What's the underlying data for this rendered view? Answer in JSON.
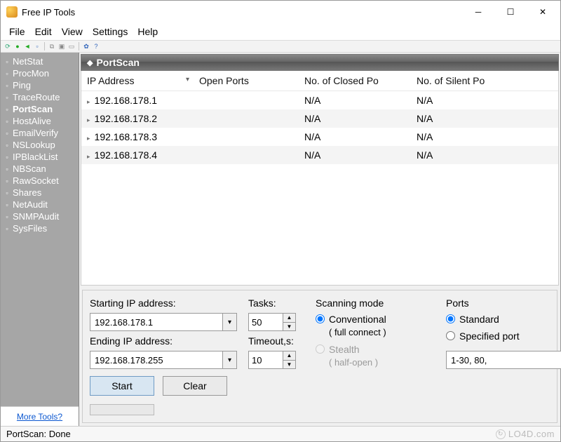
{
  "window": {
    "title": "Free IP Tools"
  },
  "menubar": [
    "File",
    "Edit",
    "View",
    "Settings",
    "Help"
  ],
  "toolbar_icons": [
    "refresh-icon",
    "play-icon",
    "back-icon",
    "save-icon",
    "sep",
    "copy-icon",
    "paste-icon",
    "clear-icon",
    "sep",
    "settings-icon",
    "help-icon"
  ],
  "sidebar": {
    "items": [
      {
        "label": "NetStat",
        "selected": false
      },
      {
        "label": "ProcMon",
        "selected": false
      },
      {
        "label": "Ping",
        "selected": false
      },
      {
        "label": "TraceRoute",
        "selected": false
      },
      {
        "label": "PortScan",
        "selected": true
      },
      {
        "label": "HostAlive",
        "selected": false
      },
      {
        "label": "EmailVerify",
        "selected": false
      },
      {
        "label": "NSLookup",
        "selected": false
      },
      {
        "label": "IPBlackList",
        "selected": false
      },
      {
        "label": "NBScan",
        "selected": false
      },
      {
        "label": "RawSocket",
        "selected": false
      },
      {
        "label": "Shares",
        "selected": false
      },
      {
        "label": "NetAudit",
        "selected": false
      },
      {
        "label": "SNMPAudit",
        "selected": false
      },
      {
        "label": "SysFiles",
        "selected": false
      }
    ],
    "footer_link": "More Tools?"
  },
  "panel": {
    "title": "PortScan"
  },
  "grid": {
    "columns": [
      "IP Address",
      "Open Ports",
      "No. of Closed Po",
      "No. of Silent Po"
    ],
    "rows": [
      {
        "ip": "192.168.178.1",
        "open": "",
        "closed": "N/A",
        "silent": "N/A"
      },
      {
        "ip": "192.168.178.2",
        "open": "",
        "closed": "N/A",
        "silent": "N/A"
      },
      {
        "ip": "192.168.178.3",
        "open": "",
        "closed": "N/A",
        "silent": "N/A"
      },
      {
        "ip": "192.168.178.4",
        "open": "",
        "closed": "N/A",
        "silent": "N/A"
      }
    ]
  },
  "controls": {
    "start_ip_label": "Starting IP address:",
    "start_ip_value": "192.168.178.1",
    "end_ip_label": "Ending IP address:",
    "end_ip_value": "192.168.178.255",
    "tasks_label": "Tasks:",
    "tasks_value": "50",
    "timeout_label": "Timeout,s:",
    "timeout_value": "10",
    "mode_label": "Scanning mode",
    "mode_conventional": "Conventional",
    "mode_conventional_sub": "( full connect )",
    "mode_stealth": "Stealth",
    "mode_stealth_sub": "( half-open )",
    "ports_label": "Ports",
    "ports_standard": "Standard",
    "ports_specified": "Specified port",
    "ports_spec_value": "1-30, 80,",
    "start_btn": "Start",
    "clear_btn": "Clear"
  },
  "statusbar": {
    "text": "PortScan: Done",
    "watermark": "LO4D.com"
  }
}
